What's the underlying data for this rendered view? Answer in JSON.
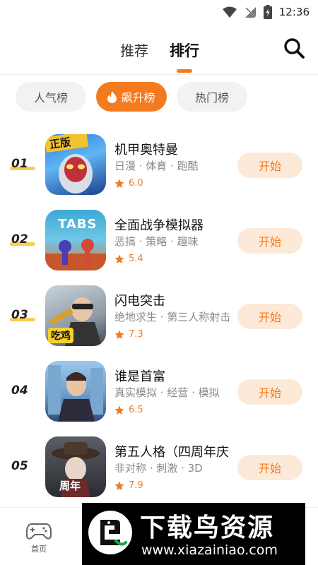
{
  "status_bar": {
    "time": "12:36"
  },
  "header": {
    "tabs": [
      {
        "label": "推荐",
        "active": false
      },
      {
        "label": "排行",
        "active": true
      }
    ]
  },
  "filters": [
    {
      "label": "人气榜",
      "active": false
    },
    {
      "label": "飙升榜",
      "active": true,
      "icon": "flame-icon"
    },
    {
      "label": "热门榜",
      "active": false
    }
  ],
  "games": [
    {
      "rank": "01",
      "title": "机甲奥特曼",
      "tags": "日漫 · 体育 · 跑酷",
      "score": "6.0",
      "button": "开始",
      "icon_text": "正版"
    },
    {
      "rank": "02",
      "title": "全面战争模拟器",
      "tags": "恶搞 · 策略 · 趣味",
      "score": "5.4",
      "button": "开始",
      "icon_text": "TABS"
    },
    {
      "rank": "03",
      "title": "闪电突击",
      "tags": "绝地求生 · 第三人称射击",
      "score": "7.3",
      "button": "开始",
      "icon_text": "吃鸡"
    },
    {
      "rank": "04",
      "title": "谁是首富",
      "tags": "真实模拟 · 经营 · 模拟",
      "score": "6.5",
      "button": "开始",
      "icon_text": ""
    },
    {
      "rank": "05",
      "title": "第五人格（四周年庆",
      "tags": "非对称 · 刺激 · 3D",
      "score": "7.9",
      "button": "开始",
      "icon_text": "周年"
    }
  ],
  "bottom_nav": {
    "home_label": "首页"
  },
  "watermark": {
    "title": "下载鸟资源",
    "url": "www.xiazainiao.com"
  },
  "colors": {
    "accent": "#f47a1f",
    "accent_light": "#fde9d8",
    "chip_bg": "#f2f2f2",
    "rank_mark": "#f7c531"
  }
}
